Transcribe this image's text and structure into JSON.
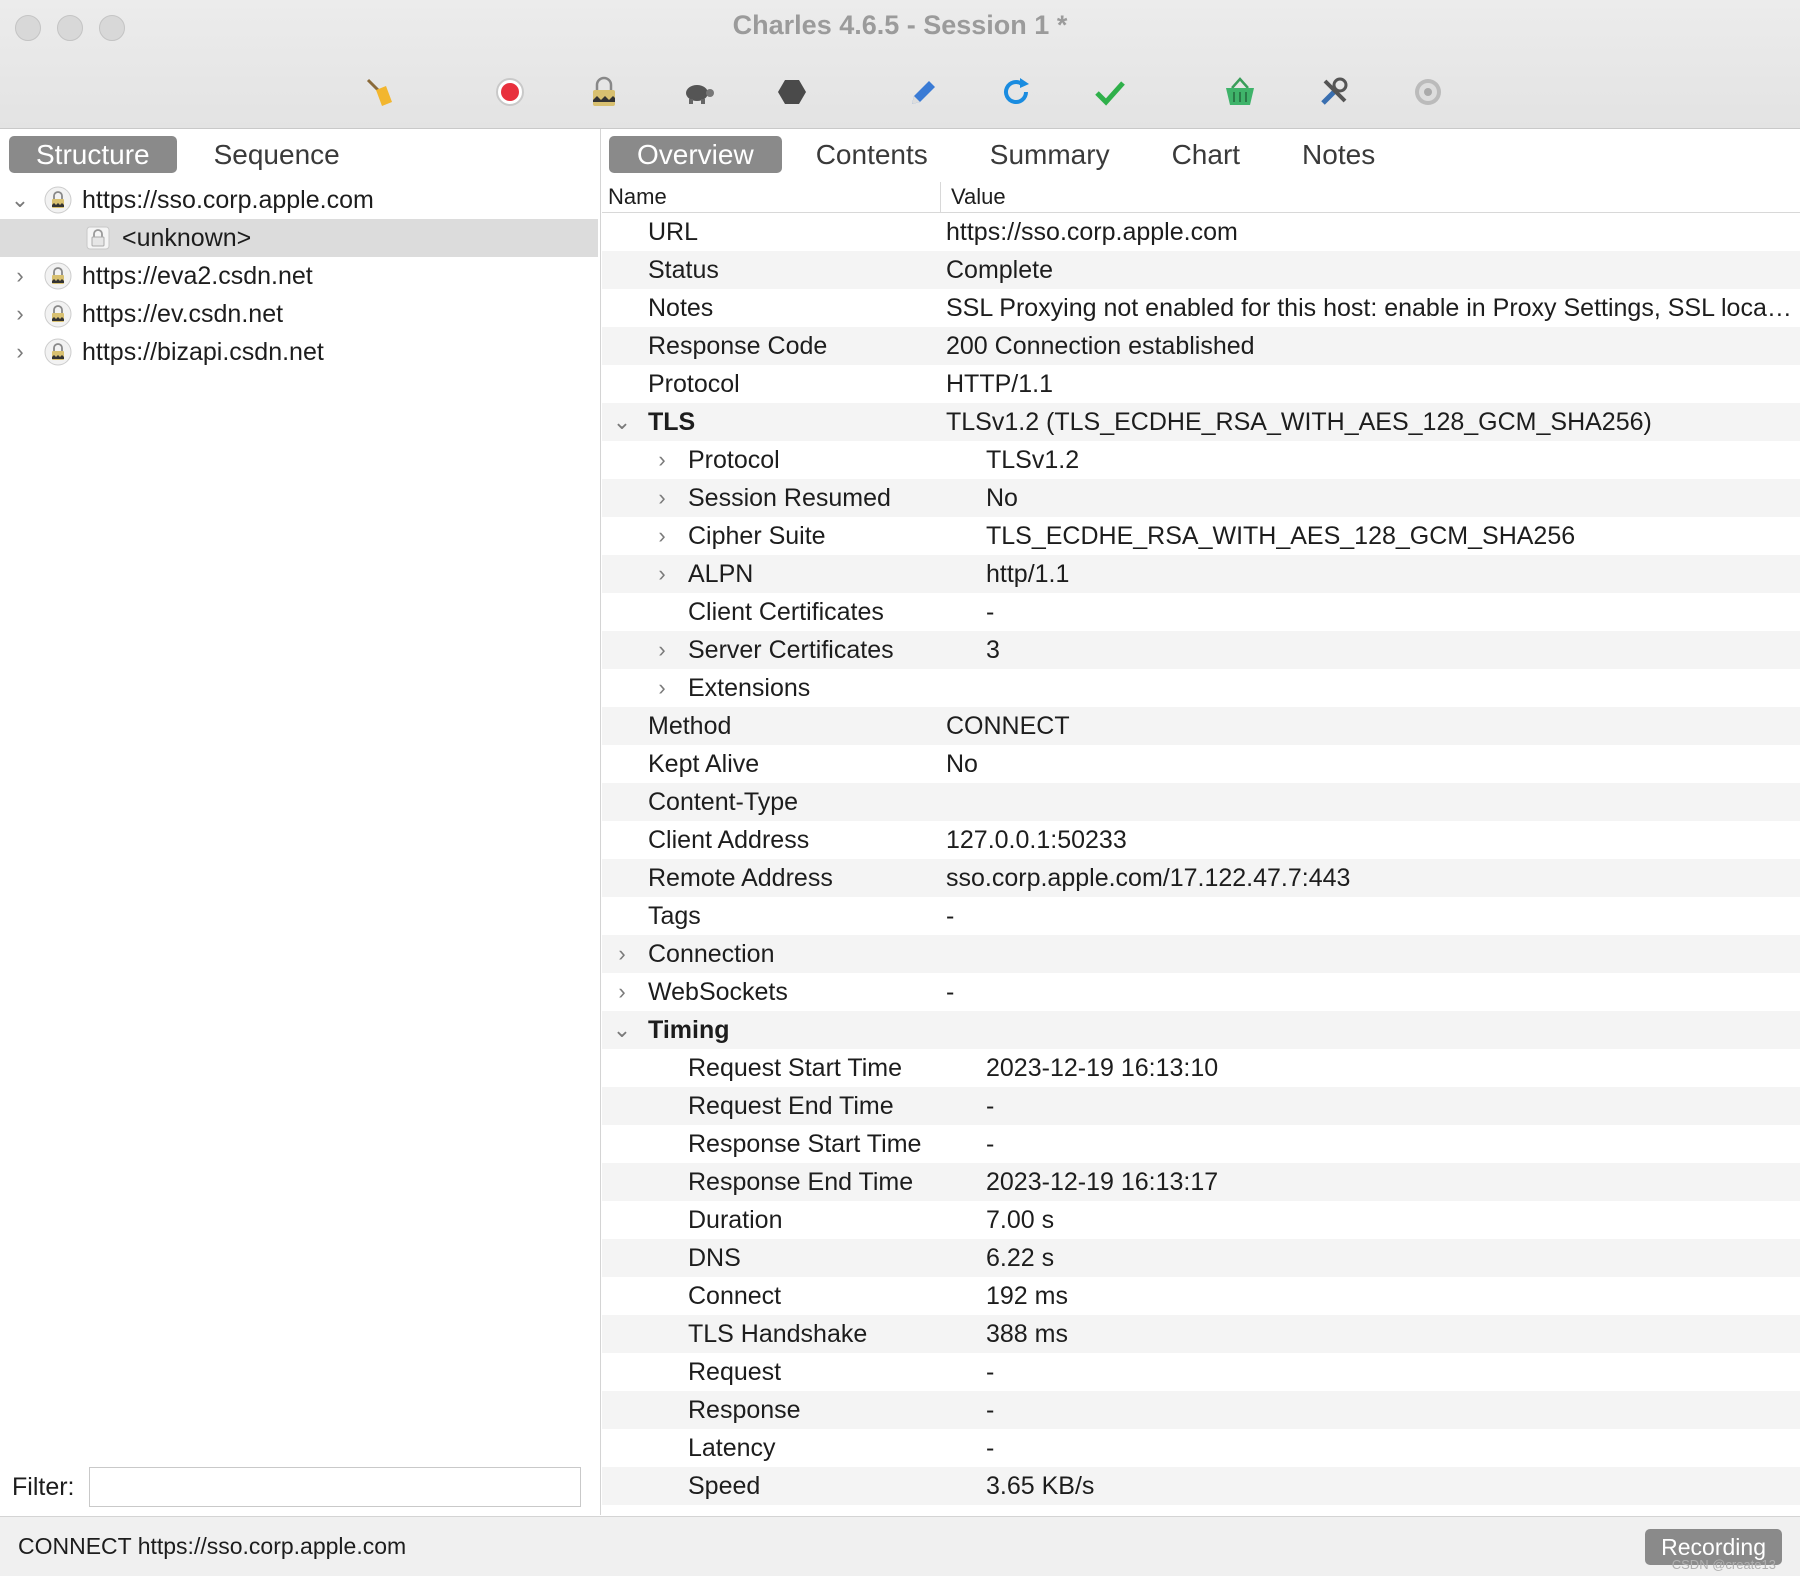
{
  "window": {
    "title": "Charles 4.6.5 - Session 1 *"
  },
  "toolbar": {
    "icons": [
      "broom-icon",
      "record-icon",
      "ssl-proxy-lock-icon",
      "throttle-turtle-icon",
      "breakpoint-hexagon-icon",
      "compose-pen-icon",
      "repeat-refresh-icon",
      "validate-check-icon",
      "basket-icon",
      "tools-icon",
      "settings-gear-icon"
    ]
  },
  "left": {
    "tabs": [
      {
        "label": "Structure",
        "active": true
      },
      {
        "label": "Sequence",
        "active": false
      }
    ],
    "tree": [
      {
        "label": "https://sso.corp.apple.com",
        "expanded": true,
        "level": 0
      },
      {
        "label": "<unknown>",
        "level": 1,
        "selected": true
      },
      {
        "label": "https://eva2.csdn.net",
        "expanded": false,
        "level": 0
      },
      {
        "label": "https://ev.csdn.net",
        "expanded": false,
        "level": 0
      },
      {
        "label": "https://bizapi.csdn.net",
        "expanded": false,
        "level": 0
      }
    ],
    "filter_label": "Filter:",
    "filter_value": ""
  },
  "right": {
    "tabs": [
      {
        "label": "Overview",
        "active": true
      },
      {
        "label": "Contents",
        "active": false
      },
      {
        "label": "Summary",
        "active": false
      },
      {
        "label": "Chart",
        "active": false
      },
      {
        "label": "Notes",
        "active": false
      }
    ],
    "headers": {
      "name": "Name",
      "value": "Value"
    },
    "rows": [
      {
        "name": "URL",
        "value": "https://sso.corp.apple.com",
        "level": 0,
        "caret": ""
      },
      {
        "name": "Status",
        "value": "Complete",
        "level": 0,
        "caret": ""
      },
      {
        "name": "Notes",
        "value": "SSL Proxying not enabled for this host: enable in Proxy Settings, SSL locat...",
        "level": 0,
        "caret": ""
      },
      {
        "name": "Response Code",
        "value": "200 Connection established",
        "level": 0,
        "caret": ""
      },
      {
        "name": "Protocol",
        "value": "HTTP/1.1",
        "level": 0,
        "caret": ""
      },
      {
        "name": "TLS",
        "value": "TLSv1.2 (TLS_ECDHE_RSA_WITH_AES_128_GCM_SHA256)",
        "level": 0,
        "caret": "down",
        "bold": true
      },
      {
        "name": "Protocol",
        "value": "TLSv1.2",
        "level": 1,
        "caret": "right"
      },
      {
        "name": "Session Resumed",
        "value": "No",
        "level": 1,
        "caret": "right"
      },
      {
        "name": "Cipher Suite",
        "value": "TLS_ECDHE_RSA_WITH_AES_128_GCM_SHA256",
        "level": 1,
        "caret": "right"
      },
      {
        "name": "ALPN",
        "value": "http/1.1",
        "level": 1,
        "caret": "right"
      },
      {
        "name": "Client Certificates",
        "value": "-",
        "level": 1,
        "caret": ""
      },
      {
        "name": "Server Certificates",
        "value": "3",
        "level": 1,
        "caret": "right"
      },
      {
        "name": "Extensions",
        "value": "",
        "level": 1,
        "caret": "right"
      },
      {
        "name": "Method",
        "value": "CONNECT",
        "level": 0,
        "caret": ""
      },
      {
        "name": "Kept Alive",
        "value": "No",
        "level": 0,
        "caret": ""
      },
      {
        "name": "Content-Type",
        "value": "",
        "level": 0,
        "caret": ""
      },
      {
        "name": "Client Address",
        "value": "127.0.0.1:50233",
        "level": 0,
        "caret": ""
      },
      {
        "name": "Remote Address",
        "value": "sso.corp.apple.com/17.122.47.7:443",
        "level": 0,
        "caret": ""
      },
      {
        "name": "Tags",
        "value": "-",
        "level": 0,
        "caret": ""
      },
      {
        "name": "Connection",
        "value": "",
        "level": 0,
        "caret": "right"
      },
      {
        "name": "WebSockets",
        "value": "-",
        "level": 0,
        "caret": "right"
      },
      {
        "name": "Timing",
        "value": "",
        "level": 0,
        "caret": "down",
        "bold": true
      },
      {
        "name": "Request Start Time",
        "value": "2023-12-19 16:13:10",
        "level": 1,
        "caret": ""
      },
      {
        "name": "Request End Time",
        "value": "-",
        "level": 1,
        "caret": ""
      },
      {
        "name": "Response Start Time",
        "value": "-",
        "level": 1,
        "caret": ""
      },
      {
        "name": "Response End Time",
        "value": "2023-12-19 16:13:17",
        "level": 1,
        "caret": ""
      },
      {
        "name": "Duration",
        "value": "7.00 s",
        "level": 1,
        "caret": ""
      },
      {
        "name": "DNS",
        "value": "6.22 s",
        "level": 1,
        "caret": ""
      },
      {
        "name": "Connect",
        "value": "192 ms",
        "level": 1,
        "caret": ""
      },
      {
        "name": "TLS Handshake",
        "value": "388 ms",
        "level": 1,
        "caret": ""
      },
      {
        "name": "Request",
        "value": "-",
        "level": 1,
        "caret": ""
      },
      {
        "name": "Response",
        "value": "-",
        "level": 1,
        "caret": ""
      },
      {
        "name": "Latency",
        "value": "-",
        "level": 1,
        "caret": ""
      },
      {
        "name": "Speed",
        "value": "3.65 KB/s",
        "level": 1,
        "caret": ""
      }
    ]
  },
  "status": {
    "text": "CONNECT https://sso.corp.apple.com",
    "recording_label": "Recording",
    "watermark": "CSDN @create13"
  }
}
